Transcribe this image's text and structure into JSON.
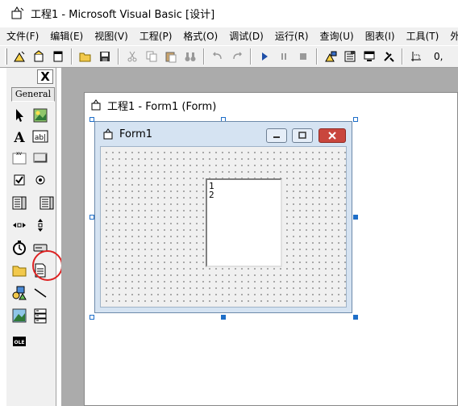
{
  "window": {
    "title": "工程1 - Microsoft Visual Basic [设计]"
  },
  "menubar": {
    "items": [
      "文件(F)",
      "编辑(E)",
      "视图(V)",
      "工程(P)",
      "格式(O)",
      "调试(D)",
      "运行(R)",
      "查询(U)",
      "图表(I)",
      "工具(T)",
      "外接程序(A"
    ]
  },
  "toolbar": {
    "coord_readout": "0,"
  },
  "toolbox": {
    "close_label": "X",
    "tab_label": "General",
    "tools": [
      "pointer-icon",
      "picturebox-icon",
      "label-icon",
      "textbox-icon",
      "frame-icon",
      "commandbutton-icon",
      "checkbox-icon",
      "optionbutton-icon",
      "combobox-icon",
      "listbox-icon",
      "hscrollbar-icon",
      "vscrollbar-icon",
      "timer-icon",
      "drivelistbox-icon",
      "dirlistbox-icon",
      "filelistbox-icon",
      "shape-icon",
      "line-icon",
      "image-icon",
      "data-icon",
      "ole-icon"
    ]
  },
  "design_window": {
    "title": "工程1 - Form1 (Form)"
  },
  "form": {
    "title": "Form1"
  },
  "listbox": {
    "items": [
      "1",
      "2"
    ]
  },
  "colors": {
    "form_title_bg": "#d5e3f2",
    "close_button": "#c9463d",
    "selection_handle": "#1e6ec8",
    "mdi_background": "#ababab",
    "highlight_circle": "#dd2222"
  }
}
